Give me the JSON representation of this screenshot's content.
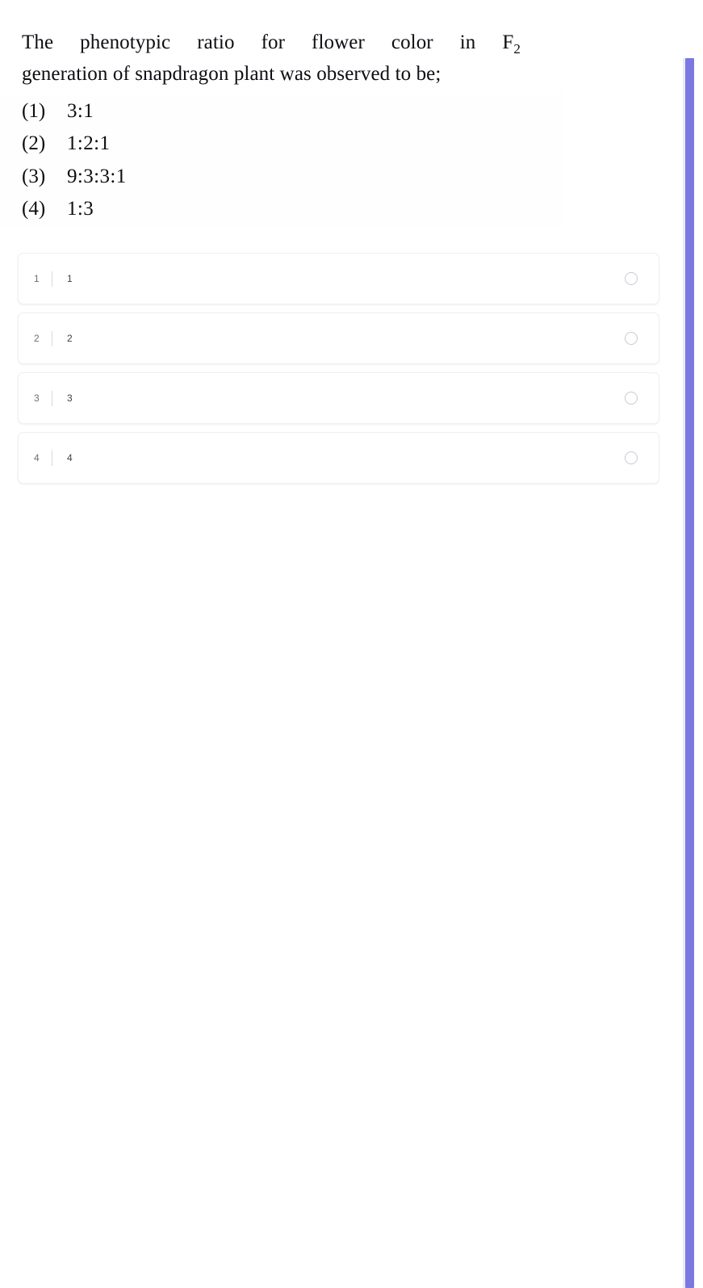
{
  "theme": {
    "accent_color": "#7b79e0",
    "card_background": "#ffffff",
    "card_border": "#f0f0f3",
    "page_background": "#ffffff",
    "radio_border": "#c9c9d2",
    "divider_color": "#d9d9e0"
  },
  "question": {
    "stem_line_1": "The phenotypic ratio for flower color in F",
    "stem_line_1_subscript": "2",
    "stem_line_2": "generation of snapdragon plant was observed to be;",
    "options": [
      {
        "marker": "(1)",
        "text": "3:1"
      },
      {
        "marker": "(2)",
        "text": "1:2:1"
      },
      {
        "marker": "(3)",
        "text": "9:3:3:1"
      },
      {
        "marker": "(4)",
        "text": "1:3"
      }
    ]
  },
  "answer_choices": [
    {
      "index": "1",
      "label": "1",
      "selected": false
    },
    {
      "index": "2",
      "label": "2",
      "selected": false
    },
    {
      "index": "3",
      "label": "3",
      "selected": false
    },
    {
      "index": "4",
      "label": "4",
      "selected": false
    }
  ],
  "icons": {
    "radio_unselected": "radio-unselected-icon"
  }
}
